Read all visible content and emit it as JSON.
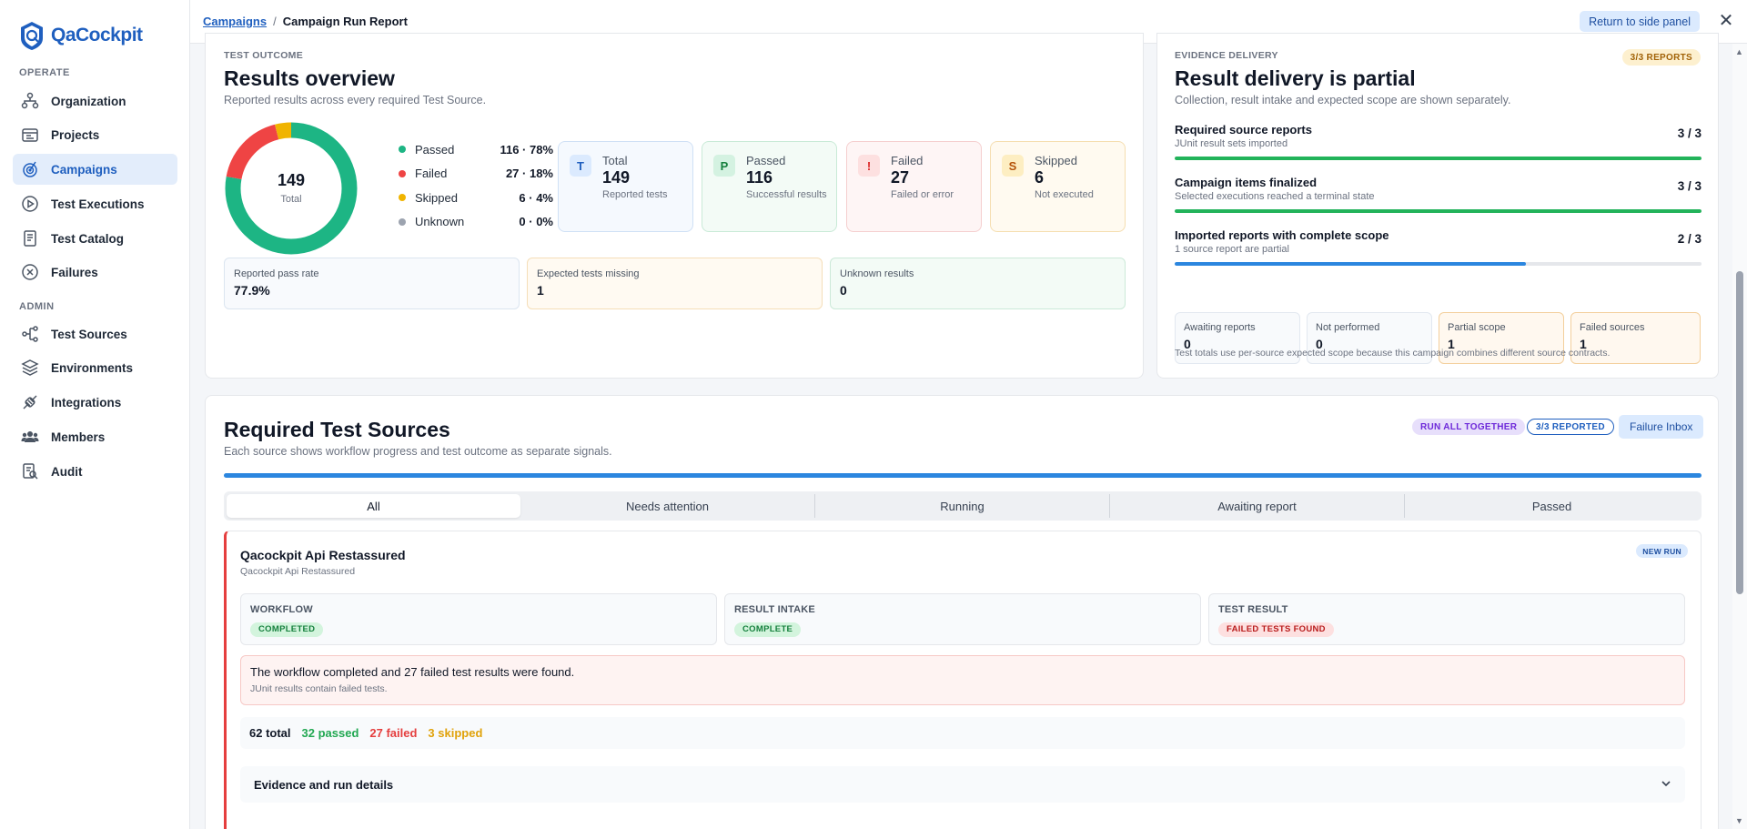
{
  "app": {
    "name": "QaCockpit"
  },
  "sidebar": {
    "sections": [
      {
        "title": "OPERATE",
        "items": [
          {
            "label": "Organization",
            "icon": "org-chart-icon"
          },
          {
            "label": "Projects",
            "icon": "projects-icon"
          },
          {
            "label": "Campaigns",
            "icon": "campaigns-icon",
            "active": true
          },
          {
            "label": "Test Executions",
            "icon": "play-circle-icon"
          },
          {
            "label": "Test Catalog",
            "icon": "catalog-icon"
          },
          {
            "label": "Failures",
            "icon": "x-circle-icon"
          }
        ]
      },
      {
        "title": "ADMIN",
        "items": [
          {
            "label": "Test Sources",
            "icon": "sources-icon"
          },
          {
            "label": "Environments",
            "icon": "layers-icon"
          },
          {
            "label": "Integrations",
            "icon": "plug-icon"
          },
          {
            "label": "Members",
            "icon": "users-icon"
          },
          {
            "label": "Audit",
            "icon": "audit-icon"
          }
        ]
      }
    ]
  },
  "header": {
    "breadcrumb_parent": "Campaigns",
    "breadcrumb_sep": "/",
    "breadcrumb_current": "Campaign Run Report",
    "return_label": "Return to side panel",
    "close_glyph": "✕"
  },
  "outcome": {
    "overline": "TEST OUTCOME",
    "title": "Results overview",
    "subtitle": "Reported results across every required Test Source.",
    "donut": {
      "total": "149",
      "total_label": "Total",
      "passed": 116,
      "failed": 27,
      "skipped": 6,
      "unknown": 0,
      "colors": {
        "passed": "#1db584",
        "failed": "#ef4444",
        "skipped": "#f0b400",
        "unknown": "#9ca3af"
      }
    },
    "legend": [
      {
        "label": "Passed",
        "value": "116 · 78%",
        "color": "#1db584"
      },
      {
        "label": "Failed",
        "value": "27 · 18%",
        "color": "#ef4444"
      },
      {
        "label": "Skipped",
        "value": "6 · 4%",
        "color": "#f0b400"
      },
      {
        "label": "Unknown",
        "value": "0 · 0%",
        "color": "#9ca3af"
      }
    ],
    "stats": [
      {
        "badge": "T",
        "label": "Total",
        "value": "149",
        "sub": "Reported tests"
      },
      {
        "badge": "P",
        "label": "Passed",
        "value": "116",
        "sub": "Successful results"
      },
      {
        "badge": "!",
        "label": "Failed",
        "value": "27",
        "sub": "Failed or error"
      },
      {
        "badge": "S",
        "label": "Skipped",
        "value": "6",
        "sub": "Not executed"
      }
    ],
    "minis": [
      {
        "label": "Reported pass rate",
        "value": "77.9%"
      },
      {
        "label": "Expected tests missing",
        "value": "1"
      },
      {
        "label": "Unknown results",
        "value": "0"
      }
    ]
  },
  "delivery": {
    "overline": "EVIDENCE DELIVERY",
    "badge": "3/3 REPORTS",
    "title": "Result delivery is partial",
    "subtitle": "Collection, result intake and expected scope are shown separately.",
    "rows": [
      {
        "title": "Required source reports",
        "sub": "JUnit result sets imported",
        "count": "3 / 3",
        "progress": 1.0,
        "color": "#22b35a"
      },
      {
        "title": "Campaign items finalized",
        "sub": "Selected executions reached a terminal state",
        "count": "3 / 3",
        "progress": 1.0,
        "color": "#22b35a"
      },
      {
        "title": "Imported reports with complete scope",
        "sub": "1 source report are partial",
        "count": "2 / 3",
        "progress": 0.667,
        "color": "#2b86df"
      }
    ],
    "boxes": [
      {
        "label": "Awaiting reports",
        "value": "0"
      },
      {
        "label": "Not performed",
        "value": "0"
      },
      {
        "label": "Partial scope",
        "value": "1"
      },
      {
        "label": "Failed sources",
        "value": "1"
      }
    ],
    "note": "Test totals use per-source expected scope because this campaign combines different source contracts."
  },
  "sources": {
    "title": "Required Test Sources",
    "subtitle": "Each source shows workflow progress and test outcome as separate signals.",
    "pill_run": "RUN ALL TOGETHER",
    "pill_reported": "3/3 REPORTED",
    "failure_inbox": "Failure Inbox",
    "tabs": [
      "All",
      "Needs attention",
      "Running",
      "Awaiting report",
      "Passed"
    ],
    "card": {
      "title": "Qacockpit Api Restassured",
      "subtitle": "Qacockpit Api Restassured",
      "badge": "NEW RUN",
      "workflow_label": "WORKFLOW",
      "workflow_value": "COMPLETED",
      "intake_label": "RESULT INTAKE",
      "intake_value": "COMPLETE",
      "result_label": "TEST RESULT",
      "result_value": "FAILED TESTS FOUND",
      "alert_title": "The workflow completed and 27 failed test results were found.",
      "alert_sub": "JUnit results contain failed tests.",
      "total": "62 total",
      "passed": "32 passed",
      "failed": "27 failed",
      "skipped": "3 skipped",
      "details": "Evidence and run details"
    }
  }
}
